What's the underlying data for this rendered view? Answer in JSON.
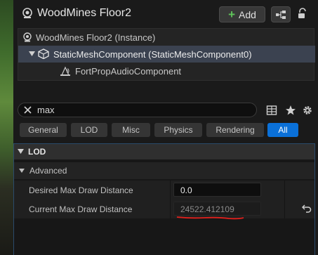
{
  "window": {
    "title": "WoodMines Floor2",
    "add_label": "Add"
  },
  "tree": {
    "items": [
      {
        "label": "WoodMines Floor2 (Instance)",
        "selected": false
      },
      {
        "label": "StaticMeshComponent (StaticMeshComponent0)",
        "selected": true
      },
      {
        "label": "FortPropAudioComponent",
        "selected": false
      }
    ]
  },
  "search": {
    "value": "max"
  },
  "filters": {
    "tabs": [
      {
        "label": "General",
        "active": false
      },
      {
        "label": "LOD",
        "active": false
      },
      {
        "label": "Misc",
        "active": false
      },
      {
        "label": "Physics",
        "active": false
      },
      {
        "label": "Rendering",
        "active": false
      },
      {
        "label": "All",
        "active": true
      }
    ]
  },
  "details": {
    "category": "LOD",
    "subcategory": "Advanced",
    "properties": [
      {
        "name": "Desired Max Draw Distance",
        "value": "0.0",
        "editable": true
      },
      {
        "name": "Current Max Draw Distance",
        "value": "24522.412109",
        "editable": false
      }
    ]
  },
  "colors": {
    "accent": "#0a70d8",
    "selected_row": "#3b4250",
    "add_plus": "#5fc35a",
    "annotation": "#e0201c"
  },
  "icons": [
    "actor-icon",
    "plus-icon",
    "blueprint-icon",
    "lock-icon",
    "static-mesh-icon",
    "audio-component-icon",
    "close-icon",
    "table-view-icon",
    "star-icon",
    "gear-icon",
    "triangle-down-icon",
    "reset-arrow-icon"
  ]
}
